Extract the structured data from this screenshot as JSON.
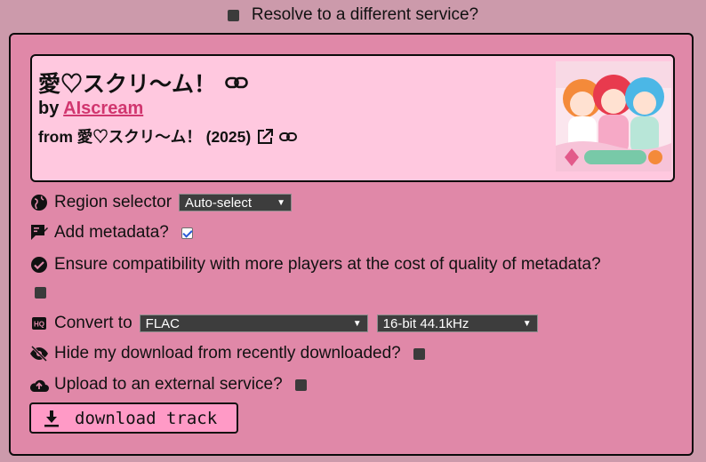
{
  "resolve": {
    "label": "Resolve to a different service?",
    "checked": false
  },
  "track": {
    "title": "愛♡スクリ〜ム！",
    "by_prefix": "by",
    "artist": "AIscream",
    "from_line": "from 愛♡スクリ〜ム！ (2025)"
  },
  "options": {
    "region_label": "Region selector",
    "region_value": "Auto-select",
    "metadata_label": "Add metadata?",
    "metadata_checked": true,
    "compat_label": "Ensure compatibility with more players at the cost of quality of metadata?",
    "compat_checked": false,
    "convert_label": "Convert to",
    "convert_format": "FLAC",
    "convert_quality": "16-bit 44.1kHz",
    "hide_label": "Hide my download from recently downloaded?",
    "hide_checked": false,
    "upload_label": "Upload to an external service?",
    "upload_checked": false
  },
  "download_button": {
    "label": "download track",
    "icon": "download-icon"
  },
  "colors": {
    "page_bg": "#cc9aab",
    "panel_bg": "#e088a8",
    "card_bg": "#ffc8df",
    "artist_link": "#d1366f",
    "button_bg": "#ff9ac6"
  }
}
